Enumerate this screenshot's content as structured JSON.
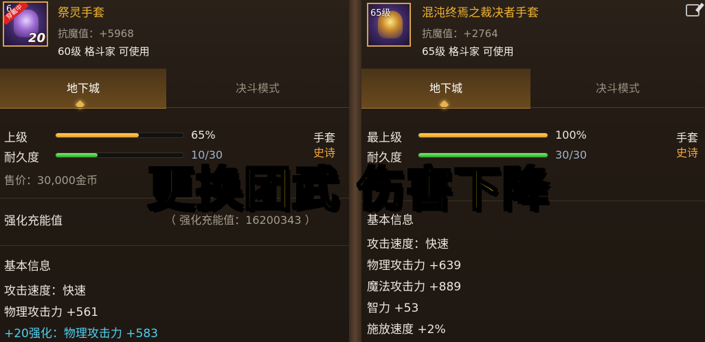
{
  "left": {
    "item": {
      "name": "祭灵手套",
      "icon_level": "6",
      "icon_badge": "穿戴中",
      "icon_number": "20",
      "stat": "抗魔值：+5968",
      "requirement": "60级 格斗家 可使用"
    },
    "tabs": [
      "地下城",
      "决斗模式"
    ],
    "active_tab": 0,
    "grade": {
      "label": "上级",
      "value": "65%",
      "percent": 65
    },
    "durability": {
      "label": "耐久度",
      "value": "10/30",
      "percent": 33
    },
    "type": "手套",
    "rarity": "史诗",
    "price": "售价：30,000金币",
    "reinforce_energy": {
      "label": "强化充能值",
      "value": "（ 强化充能值：16200343 ）"
    },
    "basic_info_title": "基本信息",
    "details": [
      "攻击速度：快速",
      "物理攻击力 +561"
    ],
    "enhance_detail": "+20强化：物理攻击力 +583"
  },
  "right": {
    "item": {
      "name": "混沌终焉之裁决者手套",
      "icon_level": "65级",
      "stat": "抗魔值：+2764",
      "requirement": "65级 格斗家 可使用"
    },
    "tabs": [
      "地下城",
      "决斗模式"
    ],
    "active_tab": 0,
    "grade": {
      "label": "最上级",
      "value": "100%",
      "percent": 100
    },
    "durability": {
      "label": "耐久度",
      "value": "30/30",
      "percent": 100
    },
    "type": "手套",
    "rarity": "史诗",
    "basic_info_title": "基本信息",
    "details": [
      "攻击速度：快速",
      "物理攻击力 +639",
      "魔法攻击力 +889",
      "智力 +53",
      "施放速度 +2%"
    ]
  },
  "caption": "更换团武 伤害下降",
  "icons": [
    "gauntlet-icon",
    "edit-icon"
  ],
  "colors": {
    "item_name": "#f0b230",
    "rarity_epic": "#f2a83c",
    "enhance_blue": "#4fd0f0",
    "caption_yellow": "#ffe400"
  }
}
